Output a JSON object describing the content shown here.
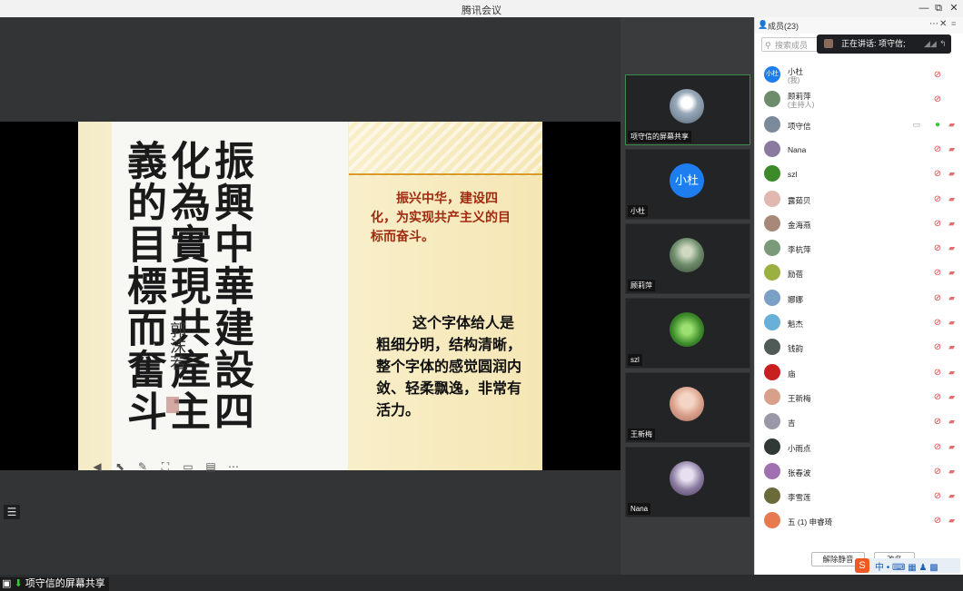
{
  "window": {
    "title": "腾讯会议",
    "minimize": "—",
    "restore": "⧉",
    "close": "✕"
  },
  "slide": {
    "calligraphy": "振興中華建設四化為實現共產主義的目標而奮斗",
    "signature": "郭沫若",
    "paragraph1": "振兴中华，建设四化，为实现共产主义的目标而奋斗。",
    "paragraph2": "这个字体给人是粗细分明，结构清晰，整个字体的感觉圆润内敛、轻柔飘逸，非常有活力。"
  },
  "share_toolbar": {
    "icons": [
      "back-icon",
      "pointer-icon",
      "pen-icon",
      "fullscreen-icon",
      "screen-icon",
      "chat-icon",
      "more-icon"
    ]
  },
  "share_label": "项守信的屏幕共享",
  "video_tiles": [
    {
      "name": "项守信的屏幕共享",
      "color": "#7a8a9a",
      "active": true
    },
    {
      "name": "小杜",
      "initials": "小杜",
      "color": "#1e7ef0"
    },
    {
      "name": "顾莉萍",
      "color": "#6d8c6a"
    },
    {
      "name": "szl",
      "color": "#3c8a2a"
    },
    {
      "name": "王新梅",
      "color": "#d8a08a"
    },
    {
      "name": "Nana",
      "color": "#8a7aa0"
    }
  ],
  "panel": {
    "title": "成员(23)",
    "search_placeholder": "搜索成员",
    "speaking": "正在讲话: 项守信;",
    "unmute_all": "解除静音",
    "more": "改名"
  },
  "members": [
    {
      "name": "小杜",
      "sub": "(我)",
      "initials": "小杜",
      "color": "#1e7ef0"
    },
    {
      "name": "顾莉萍",
      "sub": "(主持人)",
      "color": "#6d8c6a"
    },
    {
      "name": "项守信",
      "sub": "",
      "color": "#7a8a9a",
      "speaking": true
    },
    {
      "name": "Nana",
      "sub": "",
      "color": "#8a7aa0"
    },
    {
      "name": "szl",
      "sub": "",
      "color": "#3c8a2a"
    },
    {
      "name": "露茹贝",
      "sub": "",
      "color": "#e0b8b0"
    },
    {
      "name": "金海燕",
      "sub": "",
      "color": "#a88878"
    },
    {
      "name": "李杭萍",
      "sub": "",
      "color": "#7a9a7a"
    },
    {
      "name": "励蓓",
      "sub": "",
      "color": "#9ab040"
    },
    {
      "name": "娜娜",
      "sub": "",
      "color": "#7aa0c8"
    },
    {
      "name": "魁杰",
      "sub": "",
      "color": "#68b0d8"
    },
    {
      "name": "钱韵",
      "sub": "",
      "color": "#505a58"
    },
    {
      "name": "庙",
      "sub": "",
      "color": "#c82020"
    },
    {
      "name": "王新梅",
      "sub": "",
      "color": "#d8a08a"
    },
    {
      "name": "吉",
      "sub": "",
      "color": "#9898a8"
    },
    {
      "name": "小雨点",
      "sub": "",
      "color": "#303838"
    },
    {
      "name": "张春波",
      "sub": "",
      "color": "#a070b0"
    },
    {
      "name": "李雪莲",
      "sub": "",
      "color": "#6a6a3a"
    },
    {
      "name": "五 (1) 申睿琦",
      "sub": "",
      "color": "#e87a50"
    }
  ]
}
